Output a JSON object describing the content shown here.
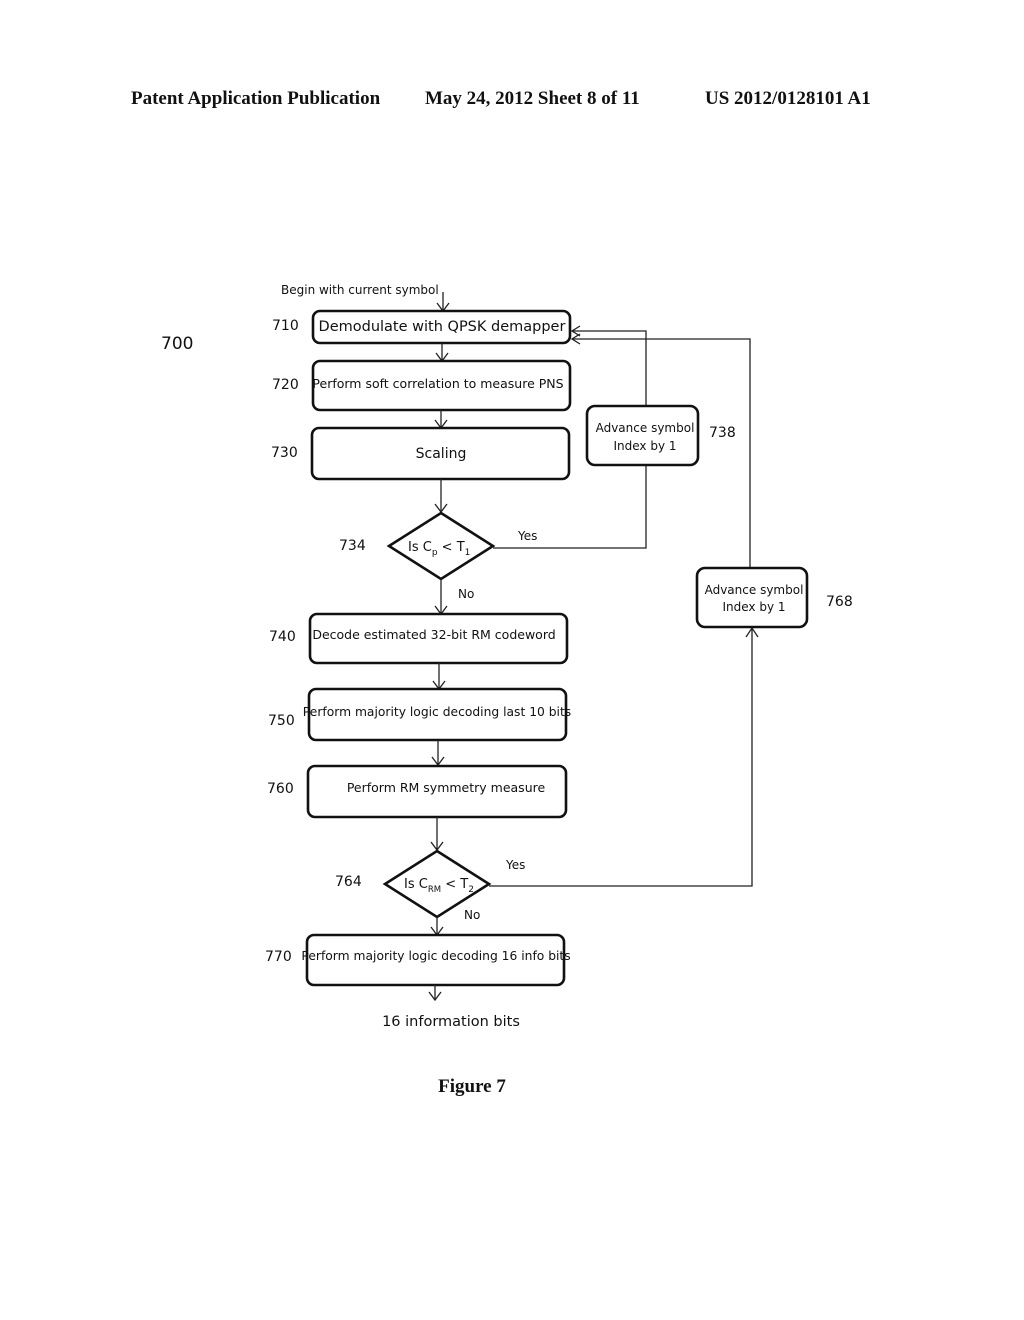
{
  "header": {
    "publication": "Patent Application Publication",
    "date_sheet": "May 24, 2012  Sheet 8 of 11",
    "patent_number": "US 2012/0128101 A1"
  },
  "figure": {
    "ref": "700",
    "caption": "Figure 7",
    "start_label": "Begin with current symbol",
    "end_label": "16 information bits",
    "steps": [
      {
        "id": "710",
        "label": "Demodulate with QPSK demapper"
      },
      {
        "id": "720",
        "label": "Perform soft correlation to measure PNS"
      },
      {
        "id": "730",
        "label": "Scaling"
      },
      {
        "id": "740",
        "label": "Decode estimated 32-bit RM codeword"
      },
      {
        "id": "750",
        "label": "Perform majority logic decoding last 10 bits"
      },
      {
        "id": "760",
        "label": "Perform RM symmetry measure"
      },
      {
        "id": "770",
        "label": "Perform majority logic decoding 16 info bits"
      }
    ],
    "decisions": [
      {
        "id": "734",
        "prefix": "Is C",
        "sub1": "p",
        "mid": " < T",
        "sub2": "1",
        "yes": "Yes",
        "no": "No"
      },
      {
        "id": "764",
        "prefix": "Is C",
        "sub1": "RM",
        "mid": " < T",
        "sub2": "2",
        "yes": "Yes",
        "no": "No"
      }
    ],
    "loops": [
      {
        "id": "738",
        "line1": "Advance symbol",
        "line2": "Index by 1"
      },
      {
        "id": "768",
        "line1": "Advance symbol",
        "line2": "Index by 1"
      }
    ]
  }
}
